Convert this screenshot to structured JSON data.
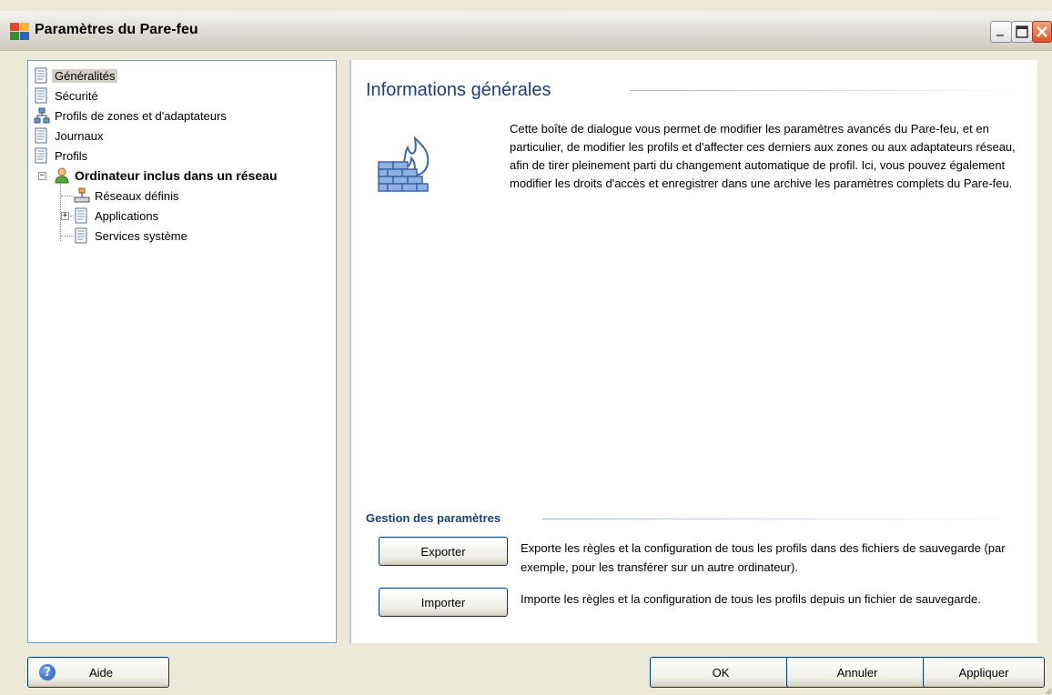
{
  "window": {
    "title": "Paramètres du Pare-feu"
  },
  "tree": {
    "items": [
      {
        "label": "Généralités",
        "icon": "document-list-icon",
        "selected": true
      },
      {
        "label": "Sécurité",
        "icon": "document-list-icon"
      },
      {
        "label": "Profils de zones et d'adaptateurs",
        "icon": "network-icon"
      },
      {
        "label": "Journaux",
        "icon": "document-list-icon"
      },
      {
        "label": "Profils",
        "icon": "document-list-icon"
      },
      {
        "label": "Ordinateur inclus dans un réseau",
        "icon": "user-icon",
        "expanded": true
      },
      {
        "label": "Réseaux définis",
        "icon": "network-icon"
      },
      {
        "label": "Applications",
        "icon": "document-list-icon",
        "expanded": false
      },
      {
        "label": "Services système",
        "icon": "document-list-icon"
      }
    ]
  },
  "content": {
    "heading": "Informations générales",
    "description": "Cette boîte de dialogue vous permet de modifier les paramètres avancés du Pare-feu, et en particulier, de modifier les profils et d'affecter ces derniers aux zones ou aux adaptateurs réseau, afin de tirer pleinement parti du changement automatique de profil. Ici, vous pouvez également modifier les droits d'accès et enregistrer dans une archive les paramètres complets du Pare-feu.",
    "section_title": "Gestion des paramètres",
    "export_label": "Exporter",
    "export_desc": "Exporte les règles et la configuration de tous les profils dans des fichiers de sauvegarde (par exemple, pour les transférer sur un autre ordinateur).",
    "import_label": "Importer",
    "import_desc": "Importe les règles et la configuration de tous les profils depuis un fichier de sauvegarde."
  },
  "footer": {
    "help_label": "Aide",
    "ok_label": "OK",
    "cancel_label": "Annuler",
    "apply_label": "Appliquer"
  },
  "colors": {
    "heading": "#1c3f73",
    "selection": "#d4d0c8",
    "window_bg": "#ece9d8"
  }
}
